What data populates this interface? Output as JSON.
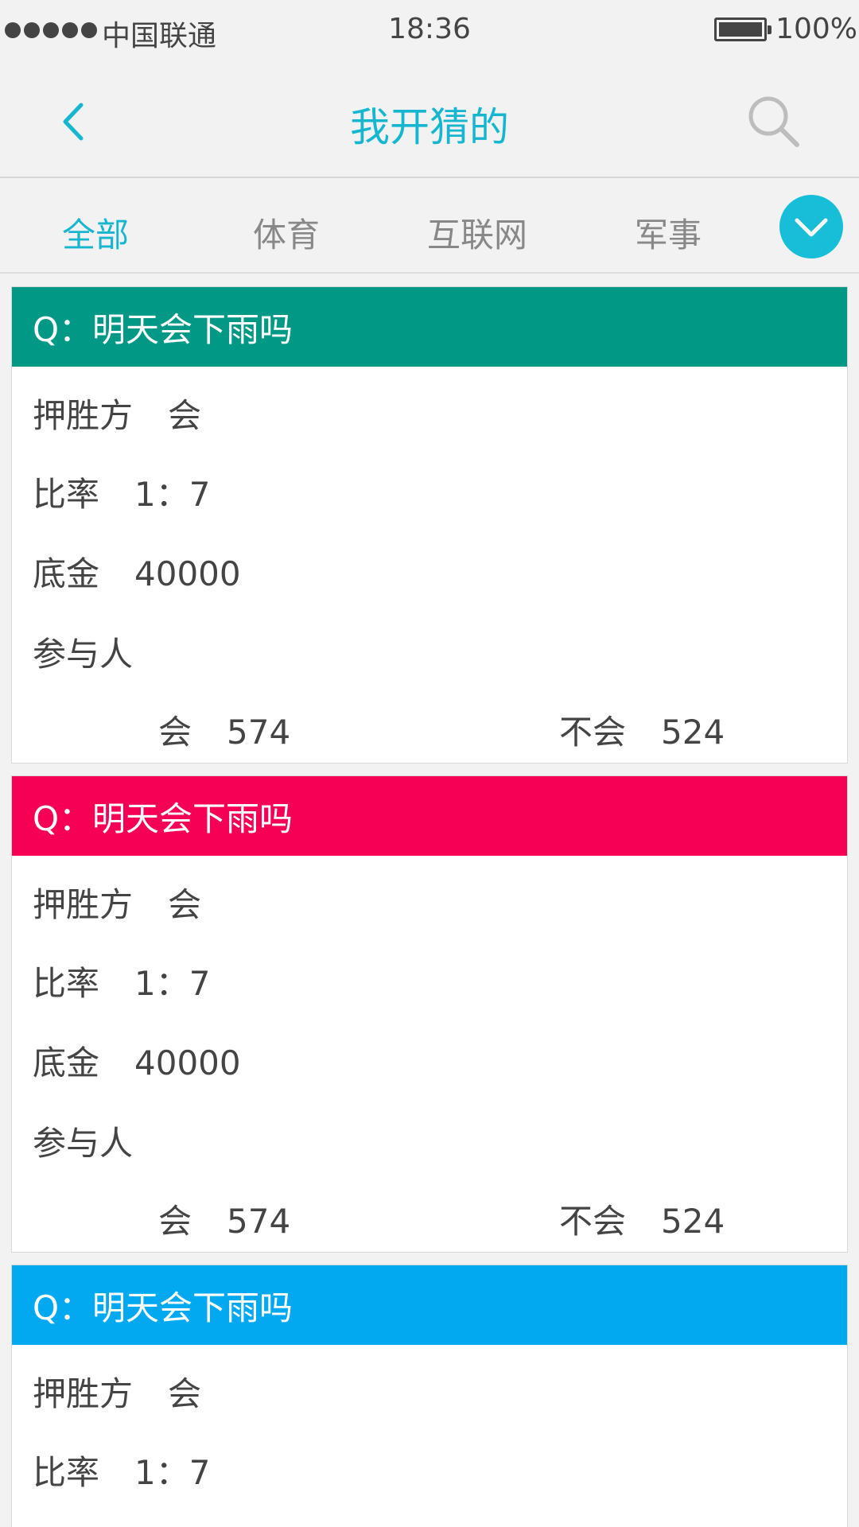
{
  "status_bar": {
    "carrier": "中国联通",
    "time": "18:36",
    "battery": "100%"
  },
  "nav": {
    "title": "我开猜的",
    "back_icon": "chevron-left-icon",
    "search_icon": "search-icon"
  },
  "tabs": [
    {
      "label": "全部",
      "active": true
    },
    {
      "label": "体育",
      "active": false
    },
    {
      "label": "互联网",
      "active": false
    },
    {
      "label": "军事",
      "active": false
    }
  ],
  "tabs_more_icon": "chevron-down-icon",
  "colors": {
    "accent": "#16b6cf",
    "card_1_header": "#019885",
    "card_2_header": "#f60055",
    "card_3_header": "#02a9f1"
  },
  "cards": [
    {
      "question": "Q：明天会下雨吗",
      "winner_label": "押胜方",
      "winner_value": "会",
      "odds_label": "比率",
      "odds_value": "1：7",
      "pot_label": "底金",
      "pot_value": "40000",
      "participants_label": "参与人",
      "yes_label": "会",
      "yes_count": "574",
      "no_label": "不会",
      "no_count": "524"
    },
    {
      "question": "Q：明天会下雨吗",
      "winner_label": "押胜方",
      "winner_value": "会",
      "odds_label": "比率",
      "odds_value": "1：7",
      "pot_label": "底金",
      "pot_value": "40000",
      "participants_label": "参与人",
      "yes_label": "会",
      "yes_count": "574",
      "no_label": "不会",
      "no_count": "524"
    },
    {
      "question": "Q：明天会下雨吗",
      "winner_label": "押胜方",
      "winner_value": "会",
      "odds_label": "比率",
      "odds_value": "1：7"
    }
  ]
}
